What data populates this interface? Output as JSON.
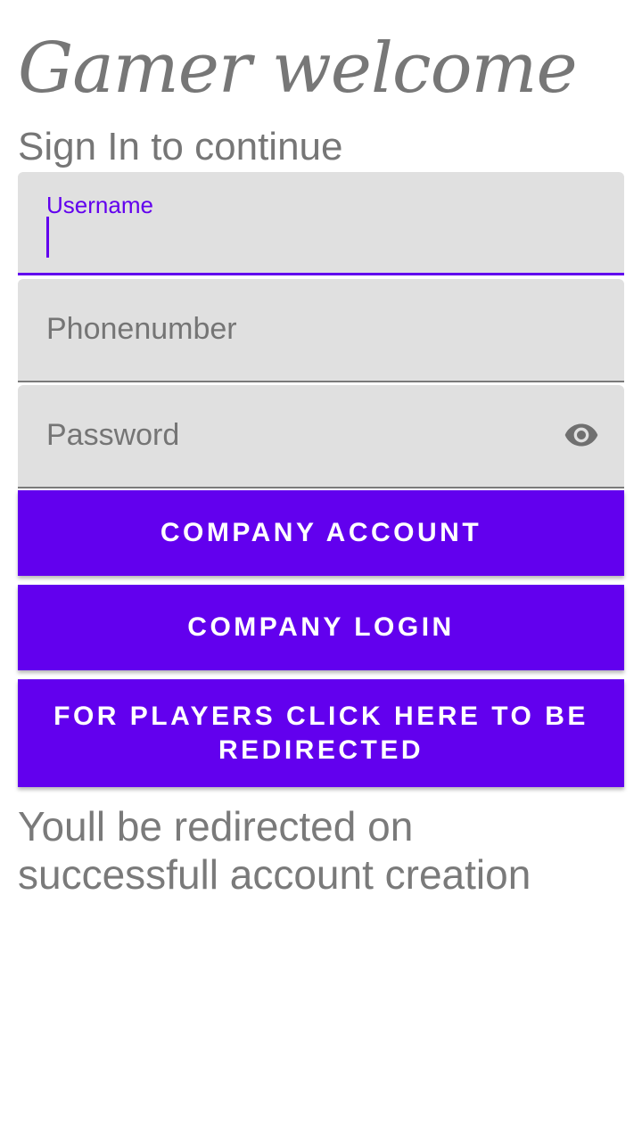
{
  "header": {
    "title": "Gamer welcome",
    "subtitle": "Sign In to continue"
  },
  "form": {
    "username": {
      "label": "Username",
      "value": ""
    },
    "phone": {
      "placeholder": "Phonenumber"
    },
    "password": {
      "placeholder": "Password",
      "toggle_icon": "eye-icon"
    }
  },
  "buttons": {
    "company_account": "COMPANY ACCOUNT",
    "company_login": "COMPANY LOGIN",
    "players_redirect": "FOR PLAYERS CLICK HERE TO BE REDIRECTED"
  },
  "note": "Youll be redirected on successfull account creation",
  "colors": {
    "accent": "#6200ee",
    "field_background": "#e0e0e0",
    "text_gray": "#777777"
  }
}
